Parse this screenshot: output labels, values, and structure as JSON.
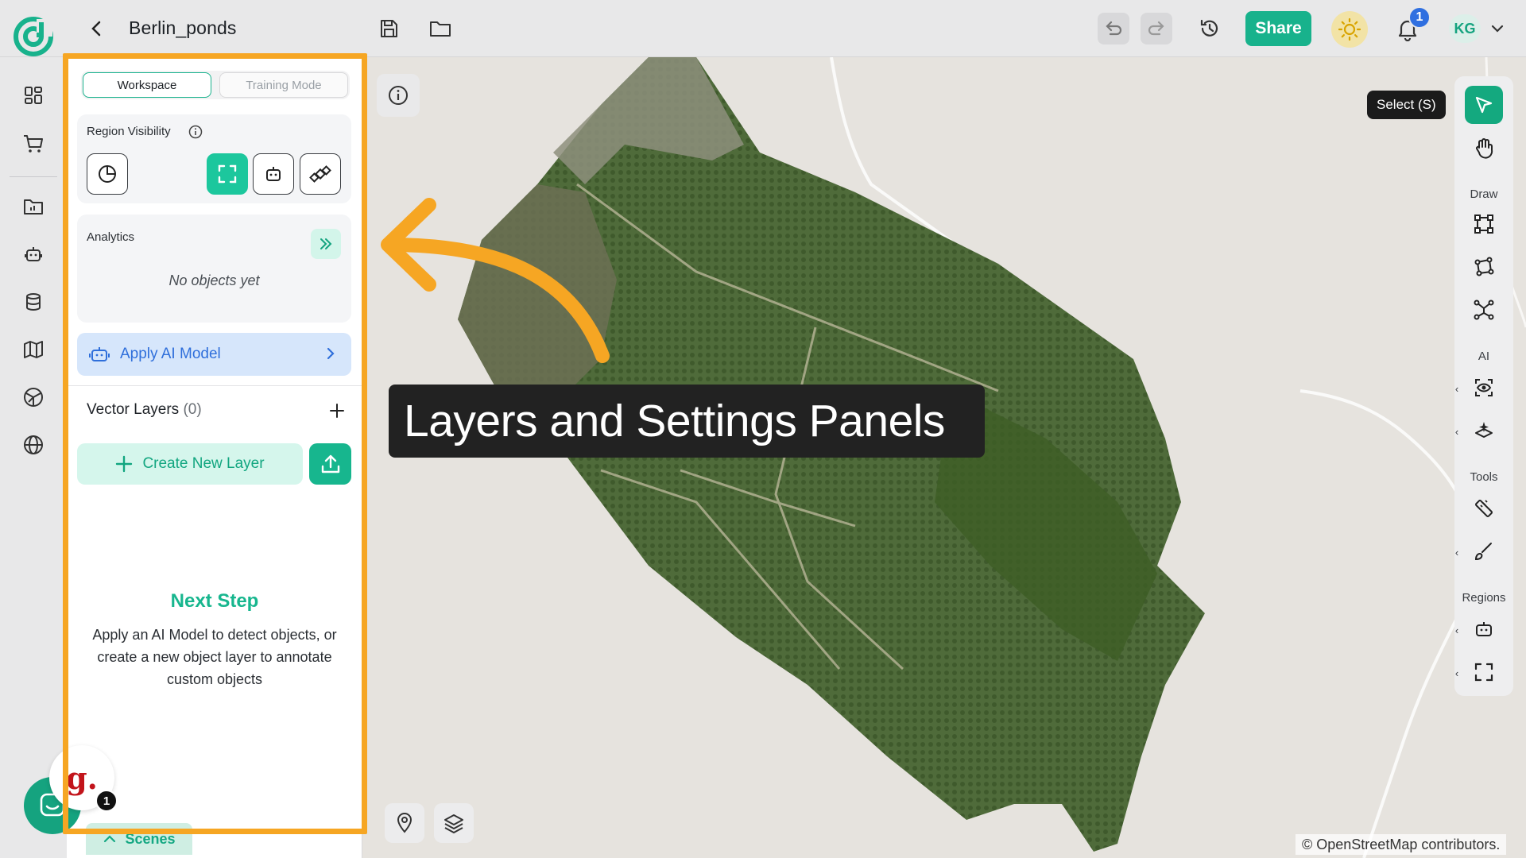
{
  "header": {
    "project_title": "Berlin_ponds",
    "share_label": "Share",
    "notifications_count": "1",
    "avatar_initials": "KG"
  },
  "panel": {
    "modes": [
      "Workspace",
      "Training Mode"
    ],
    "region_visibility_title": "Region Visibility",
    "analytics_title": "Analytics",
    "analytics_empty": "No objects yet",
    "apply_ai_label": "Apply AI Model",
    "vector_layers_title": "Vector Layers",
    "vector_layers_count": "(0)",
    "create_layer_label": "Create New Layer",
    "next_step_title": "Next Step",
    "next_step_desc": "Apply an AI Model to detect objects, or create a new object layer to annotate custom objects",
    "scenes_label": "Scenes"
  },
  "map": {
    "callout": "Layers and Settings Panels",
    "credit": "© OpenStreetMap contributors."
  },
  "right_toolbar": {
    "tooltip": "Select (S)",
    "sections": {
      "draw": "Draw",
      "ai": "AI",
      "tools": "Tools",
      "regions": "Regions"
    }
  },
  "widgets": {
    "chat_badge_letter": "g.",
    "chat_badge_count": "1"
  },
  "colors": {
    "accent": "#17b68e",
    "highlight_border": "#f6a623",
    "ai_blue": "#2f6fdb"
  }
}
